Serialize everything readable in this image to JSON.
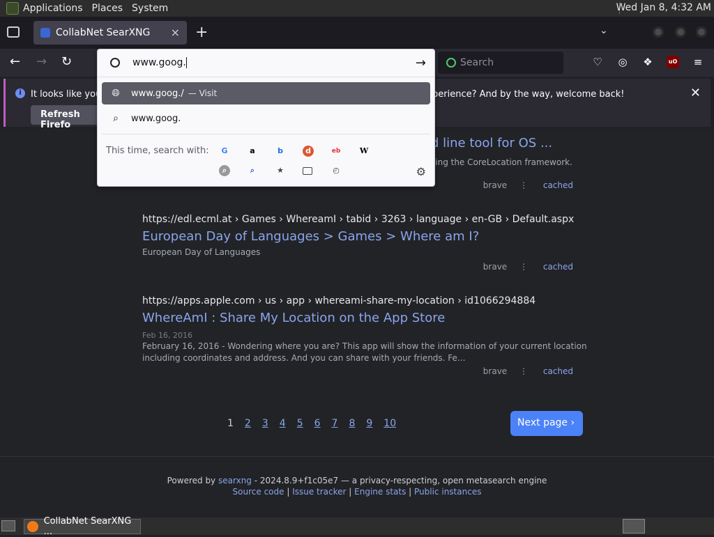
{
  "os_bar": {
    "menus": [
      "Applications",
      "Places",
      "System"
    ],
    "clock": "Wed Jan  8,  4:32 AM"
  },
  "browser": {
    "tab": {
      "title": "CollabNet SearXNG",
      "close": "×"
    },
    "newtab": "+",
    "urlbar": {
      "value": "www.goog.",
      "suggestions": [
        {
          "text": "www.goog./",
          "sub": "— Visit",
          "icon": "globe-icon"
        },
        {
          "text": "www.goog.",
          "sub": "",
          "icon": "search-icon"
        }
      ],
      "search_with_label": "This time, search with:",
      "engines": [
        "google",
        "amazon",
        "bing",
        "duckduckgo",
        "ebay",
        "wikipedia",
        "searx",
        "searxng-add",
        "bookmarks",
        "tabs",
        "history"
      ]
    },
    "search_placeholder": "Search"
  },
  "notification": {
    "text_start": "It looks like you h",
    "text_end": "perience? And by the way, welcome back!",
    "button": "Refresh Firefo"
  },
  "results": [
    {
      "url": "",
      "title": "d line tool for OS ...",
      "desc": "sing the CoreLocation framework.",
      "engine": "brave",
      "cached": "cached"
    },
    {
      "url": "https://edl.ecml.at  › Games › WhereamI › tabid › 3263 › language › en-GB › Default.aspx",
      "title": "European Day of Languages > Games > Where am I?",
      "desc": "European Day of Languages",
      "engine": "brave",
      "cached": "cached"
    },
    {
      "url": "https://apps.apple.com  › us › app › whereami-share-my-location › id1066294884",
      "title": "WhereAmI : Share My Location on the App Store",
      "date": "Feb 16, 2016",
      "desc": "February 16, 2016 - Wondering where you are? This app will show the information of your current location including coordinates and address. And you can share with your friends. Fe...",
      "engine": "brave",
      "cached": "cached"
    }
  ],
  "pagination": {
    "pages": [
      "1",
      "2",
      "3",
      "4",
      "5",
      "6",
      "7",
      "8",
      "9",
      "10"
    ],
    "current": "1",
    "next": "Next page"
  },
  "footer": {
    "powered": "Powered by",
    "searxng": "searxng",
    "version": "- 2024.8.9+f1c05e7 — a privacy-respecting, open metasearch engine",
    "links": [
      "Source code",
      "Issue tracker",
      "Engine stats",
      "Public instances"
    ]
  },
  "taskbar": {
    "task": "CollabNet SearXNG ..."
  }
}
